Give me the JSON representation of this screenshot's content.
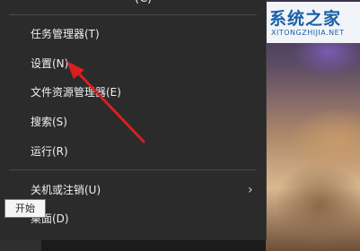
{
  "menu": {
    "items": [
      {
        "label": "任务管理器(T)"
      },
      {
        "label": "设置(N)"
      },
      {
        "label": "文件资源管理器(E)"
      },
      {
        "label": "搜索(S)"
      },
      {
        "label": "运行(R)"
      },
      {
        "label": "关机或注销(U)"
      },
      {
        "label": "桌面(D)"
      }
    ]
  },
  "tooltip": {
    "text": "开始"
  },
  "watermark": {
    "brand": "系统之家",
    "url": "XITONGZHIJIA.NET"
  },
  "colors": {
    "menu_bg": "#2b2b2b",
    "menu_text": "#f0f0f0",
    "arrow": "#d8201f",
    "logo": "#1b5fa8"
  }
}
